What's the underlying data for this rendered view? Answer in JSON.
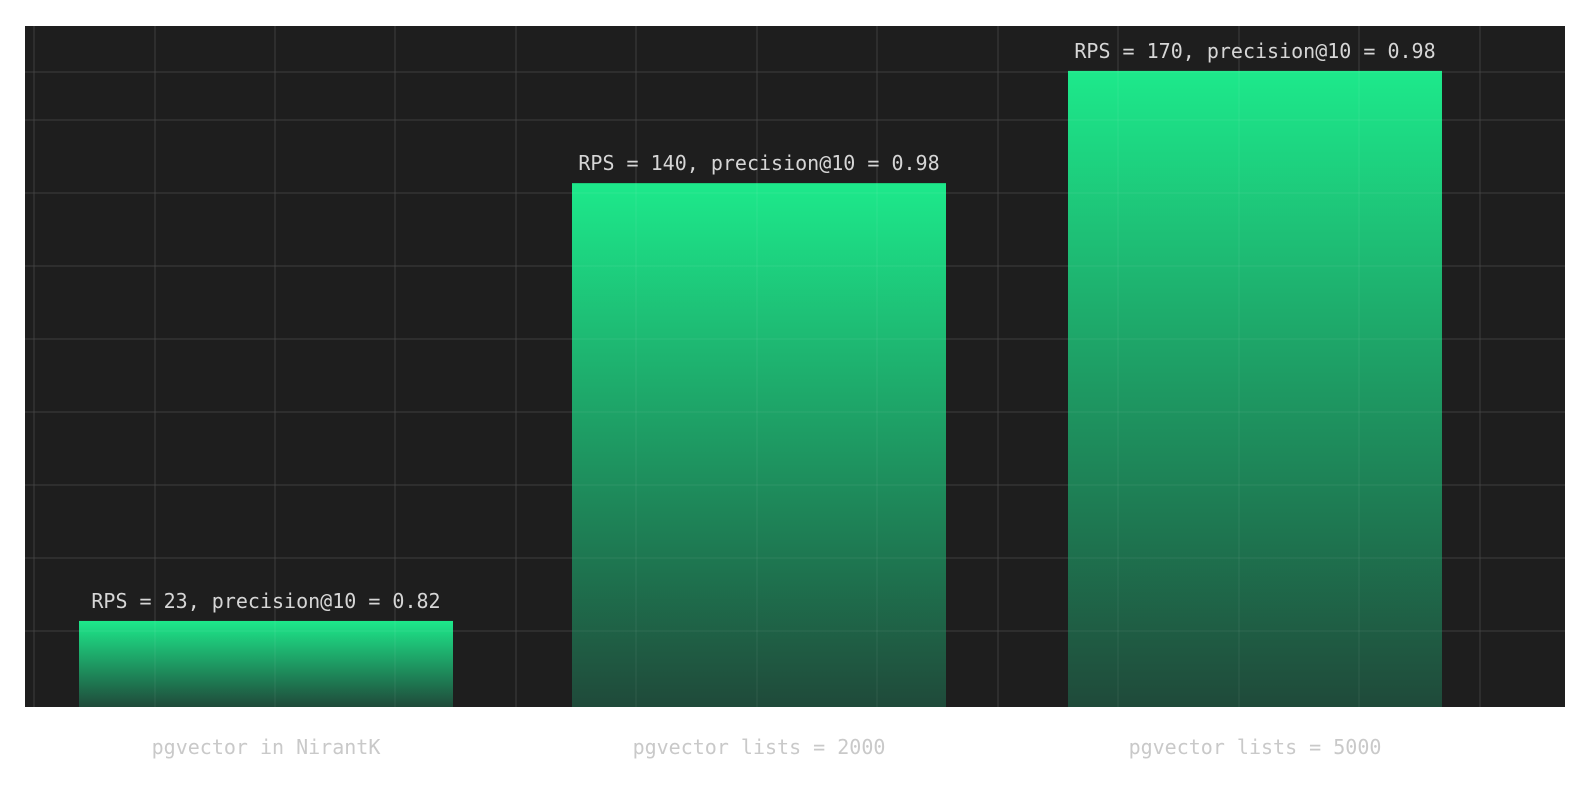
{
  "chart_data": {
    "type": "bar",
    "title": "",
    "xlabel": "",
    "ylabel": "",
    "categories": [
      "pgvector in NirantK",
      "pgvector lists = 2000",
      "pgvector lists = 5000"
    ],
    "values": [
      23,
      140,
      170
    ],
    "precision_at_10": [
      0.82,
      0.98,
      0.98
    ],
    "data_labels": [
      "RPS = 23, precision@10 = 0.82",
      "RPS = 140, precision@10 = 0.98",
      "RPS = 170, precision@10 = 0.98"
    ],
    "ylim": [
      0,
      182
    ],
    "grid": true,
    "legend": "none",
    "y_ticks_shown": false
  },
  "colors": {
    "plot_background": "#1e1e1e",
    "page_background": "#ffffff",
    "grid": "#2a2a2a",
    "bar_top": "#1de98b",
    "bar_bottom": "#1f4a3a",
    "data_label_text": "#d6d6d6",
    "category_label_text": "#c9c9c9"
  }
}
